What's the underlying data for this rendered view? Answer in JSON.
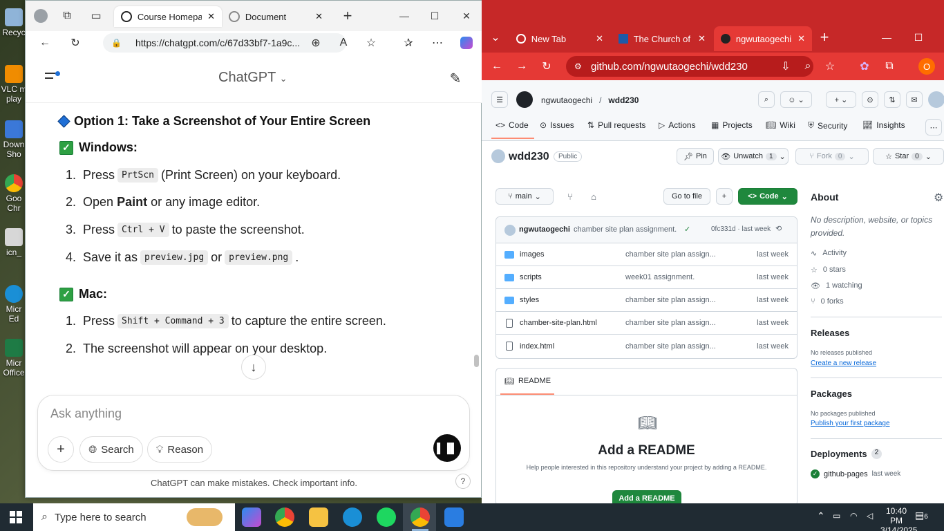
{
  "desktop": {
    "icons": [
      {
        "label": "Recyc",
        "color": "#8fb4d8"
      },
      {
        "label": "VLC m\nplay",
        "color": "#f08c00"
      },
      {
        "label": "Down\nSho",
        "color": "#3b78d8"
      },
      {
        "label": "Goo\nChr",
        "color": "#34a853"
      },
      {
        "label": "icn_",
        "color": "#d7d7d7"
      },
      {
        "label": "Micr\nEd",
        "color": "#1a8fd6"
      },
      {
        "label": "Micr\nOffice",
        "color": "#1e7b45"
      }
    ]
  },
  "edge": {
    "tabs": [
      {
        "label": "Course Homepag",
        "icon": "chatgpt-icon"
      },
      {
        "label": "Document",
        "icon": "chatgpt-icon"
      }
    ],
    "url": "https://chatgpt.com/c/67d33bf7-1a9c...",
    "chat_title": "ChatGPT",
    "option_heading": "Option 1: Take a Screenshot of Your Entire Screen",
    "windows_heading": "Windows:",
    "windows_steps": [
      {
        "num": "1.",
        "pre": "Press",
        "code": "PrtScn",
        "post": "(Print Screen) on your keyboard."
      },
      {
        "num": "2.",
        "pre": "Open",
        "bold": "Paint",
        "post": "or any image editor."
      },
      {
        "num": "3.",
        "pre": "Press",
        "code": "Ctrl + V",
        "post": "to paste the screenshot."
      },
      {
        "num": "4.",
        "pre": "Save it as",
        "code": "preview.jpg",
        "mid": "or",
        "code2": "preview.png",
        "post": "."
      }
    ],
    "mac_heading": "Mac:",
    "mac_steps": [
      {
        "num": "1.",
        "pre": "Press",
        "code": "Shift + Command + 3",
        "post": "to capture the entire screen."
      },
      {
        "num": "2.",
        "pre": "The screenshot will appear on your desktop."
      }
    ],
    "composer": {
      "placeholder": "Ask anything",
      "search": "Search",
      "reason": "Reason"
    },
    "disclaimer": "ChatGPT can make mistakes. Check important info.",
    "help": "?"
  },
  "chrome": {
    "tabs": [
      {
        "label": "New Tab"
      },
      {
        "label": "The Church of"
      },
      {
        "label": "ngwutaogechi"
      }
    ],
    "url": "github.com/ngwutaogechi/wdd230",
    "profile": "O",
    "owner": "ngwutaogechi",
    "repo": "wdd230",
    "nav": [
      "Code",
      "Issues",
      "Pull requests",
      "Actions",
      "Projects",
      "Wiki",
      "Security",
      "Insights"
    ],
    "visibility": "Public",
    "pin": "Pin",
    "unwatch": "Unwatch",
    "unwatch_count": "1",
    "fork": "Fork",
    "fork_count": "0",
    "star": "Star",
    "star_count": "0",
    "branch": "main",
    "goto_file": "Go to file",
    "code_btn": "Code",
    "commit": {
      "author": "ngwutaogechi",
      "message": "chamber site plan assignment.",
      "hash_time": "0fc331d · last week"
    },
    "files": [
      {
        "name": "images",
        "type": "folder",
        "message": "chamber site plan assign...",
        "time": "last week"
      },
      {
        "name": "scripts",
        "type": "folder",
        "message": "week01 assignment.",
        "time": "last week"
      },
      {
        "name": "styles",
        "type": "folder",
        "message": "chamber site plan assign...",
        "time": "last week"
      },
      {
        "name": "chamber-site-plan.html",
        "type": "file",
        "message": "chamber site plan assign...",
        "time": "last week"
      },
      {
        "name": "index.html",
        "type": "file",
        "message": "chamber site plan assign...",
        "time": "last week"
      }
    ],
    "readme_tab": "README",
    "readme_title": "Add a README",
    "readme_help": "Help people interested in this repository understand your project by adding a README.",
    "readme_btn": "Add a README",
    "about": {
      "title": "About",
      "desc": "No description, website, or topics provided.",
      "activity": "Activity",
      "stars": "0 stars",
      "watching": "1 watching",
      "forks": "0 forks"
    },
    "releases": {
      "title": "Releases",
      "text": "No releases published",
      "link": "Create a new release"
    },
    "packages": {
      "title": "Packages",
      "text": "No packages published",
      "link": "Publish your first package"
    },
    "deployments": {
      "title": "Deployments",
      "count": "2",
      "name": "github-pages",
      "time": "last week"
    }
  },
  "taskbar": {
    "search_placeholder": "Type here to search",
    "time": "10:40 PM",
    "date": "3/14/2025",
    "notifications": "6"
  }
}
